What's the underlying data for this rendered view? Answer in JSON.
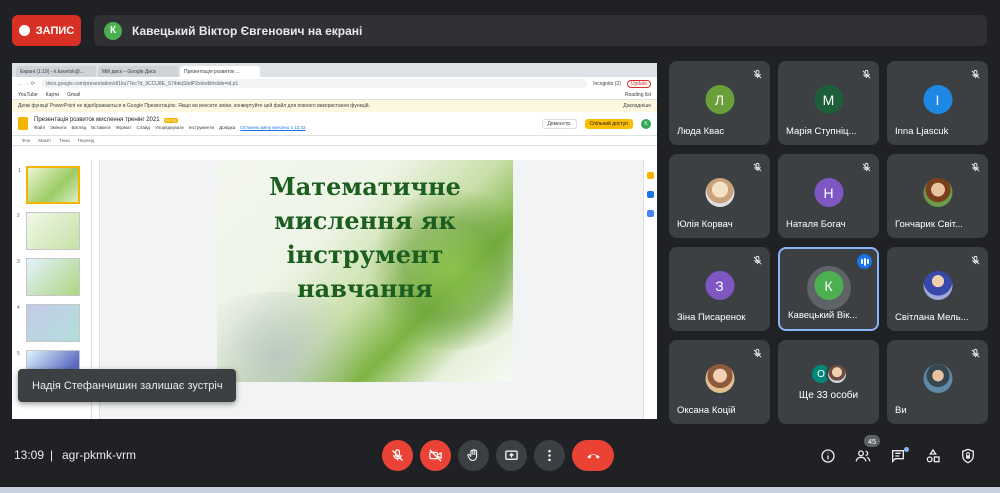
{
  "top": {
    "record_label": "ЗАПИС",
    "presenter_initial": "К",
    "presenter_text": "Кавецький Віктор Євгенович на екрані"
  },
  "browser": {
    "tabs": [
      "Екрані (1:19) - k.kavetsk@...",
      "Мій диск – Google Диск",
      "Презентація розвиток ..."
    ],
    "address": "docs.google.com/presentation/d/1ku7Tec7d_9CCU8E_S7ibkqSbdP2xt/edit#slide=id.p1",
    "incognito": "Incognito (2)",
    "update": "Update",
    "bookmarks": [
      "YouTube",
      "Карти",
      "Gmail"
    ],
    "reading_list": "Reading list",
    "warning": "Деякі функції PowerPoint не відображаються в Google Презентаціях. Якщо ви внесете зміни, конвертуйте цей файл для повного використання функцій.",
    "warning_dismiss": "Докладніше"
  },
  "slides": {
    "doc_title": "Презентація розвиток мислення тренінг 2021",
    "badge": "PPTX",
    "menu": [
      "Файл",
      "Змінити",
      "Вигляд",
      "Вставити",
      "Формат",
      "Слайд",
      "Упорядкувати",
      "Інструменти",
      "Довідка"
    ],
    "last_edit": "Останню зміну внесено о 13:42",
    "present": "Демонстр.",
    "share": "Спільний доступ",
    "account_initial": "K",
    "toolbar": [
      "Фон",
      "Макет",
      "Тема",
      "Перехід"
    ],
    "slide_title": "Математичне мислення як інструмент навчання"
  },
  "toast": "Надія Стефанчишин залишає зустріч",
  "participants": [
    {
      "name": "Люда Квас",
      "initial": "Л",
      "color": "#689f38"
    },
    {
      "name": "Марія Ступніц...",
      "initial": "М",
      "color": "#1e5e3a"
    },
    {
      "name": "Inna Ljascuk",
      "initial": "I",
      "color": "#1e88e5"
    },
    {
      "name": "Юлія Корвач",
      "initial": "",
      "color": "#d7ccc8"
    },
    {
      "name": "Наталя Богач",
      "initial": "Н",
      "color": "#7e57c2"
    },
    {
      "name": "Гончарик Світ...",
      "initial": "",
      "color": "#8d6e63"
    },
    {
      "name": "Зіна Писаренок",
      "initial": "З",
      "color": "#7e57c2"
    },
    {
      "name": "Кавецький Вік...",
      "initial": "К",
      "color": "#4caf50"
    },
    {
      "name": "Світлана Мель...",
      "initial": "",
      "color": "#3949ab"
    },
    {
      "name": "Оксана Коцій",
      "initial": "",
      "color": "#a1887f"
    },
    {
      "name": "Ви",
      "initial": "",
      "color": "#5d8aa8"
    }
  ],
  "more": {
    "text": "Ще 33 особи",
    "initial": "О",
    "color": "#00897b"
  },
  "bottom": {
    "time": "13:09",
    "separator": "|",
    "meeting_code": "agr-pkmk-vrm",
    "participant_count": "45"
  },
  "colors": {
    "background": "#202124",
    "tile": "#3c4043",
    "danger": "#ea4335",
    "accent": "#8ab4f8"
  }
}
